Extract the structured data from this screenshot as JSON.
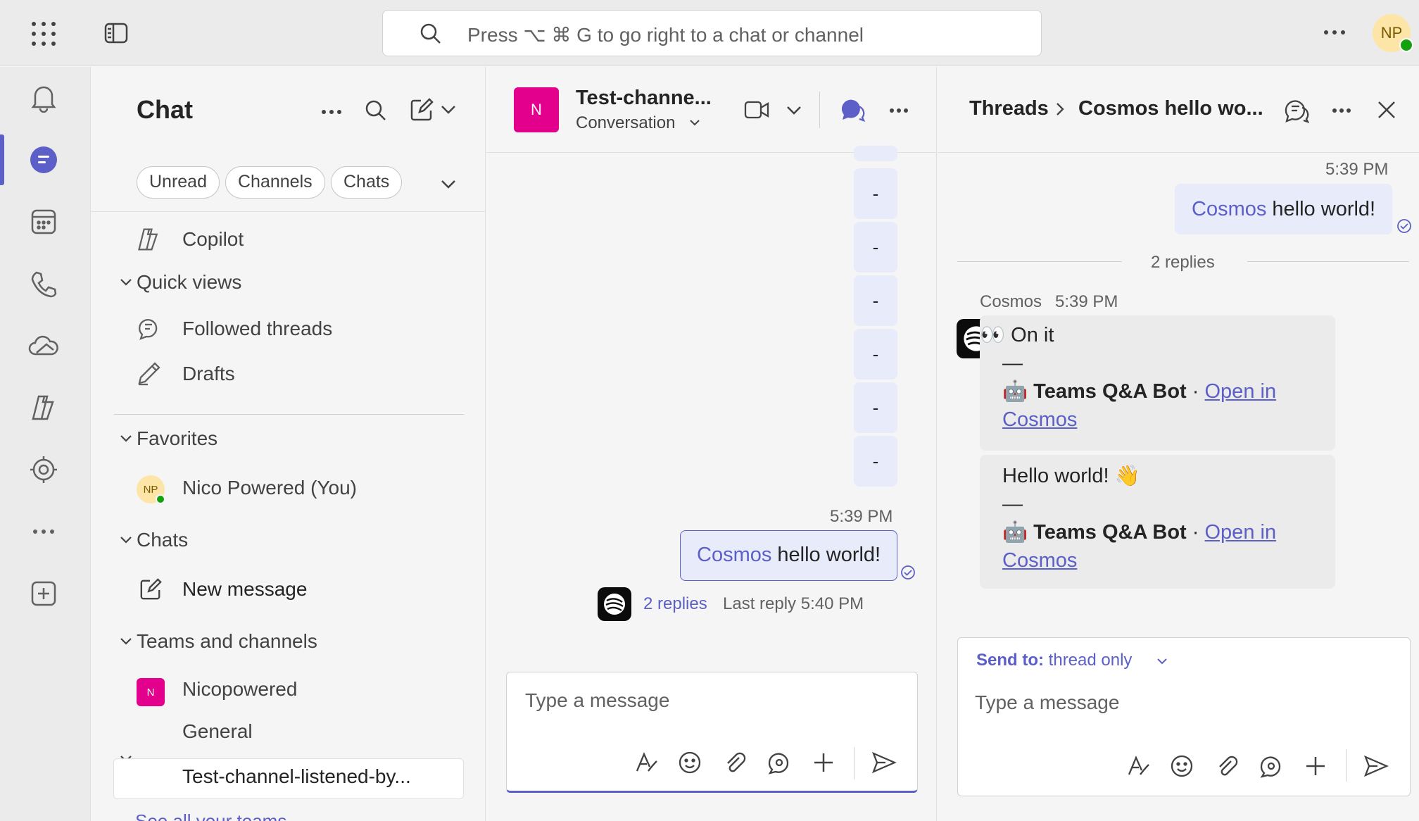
{
  "topbar": {
    "search_placeholder": "Press ⌥ ⌘ G to go right to a chat or channel",
    "user_initials": "NP"
  },
  "rail": {
    "items": [
      "bell-icon",
      "chat-icon",
      "calendar-icon",
      "phone-icon",
      "onedrive-icon",
      "copilot-icon",
      "apps-settings-icon",
      "more-icon",
      "add-app-icon"
    ],
    "active": "chat-icon"
  },
  "chat_panel": {
    "title": "Chat",
    "filters": [
      "Unread",
      "Channels",
      "Chats"
    ],
    "copilot": "Copilot",
    "quick_views": {
      "header": "Quick views",
      "items": [
        "Followed threads",
        "Drafts"
      ]
    },
    "favorites": {
      "header": "Favorites",
      "items": [
        {
          "label": "Nico Powered (You)",
          "initials": "NP"
        }
      ]
    },
    "chats": {
      "header": "Chats",
      "items": [
        "New message"
      ]
    },
    "teams": {
      "header": "Teams and channels",
      "team_name": "Nicopowered",
      "team_initial": "N",
      "channels": [
        "General",
        "Test-channel-listened-by..."
      ],
      "see_all": "See all your teams"
    }
  },
  "conversation": {
    "channel_name": "Test-channe...",
    "channel_initial": "N",
    "tab": "Conversation",
    "dash_messages": [
      "-",
      "-",
      "-",
      "-",
      "-",
      "-"
    ],
    "message": {
      "time": "5:39 PM",
      "mention": "Cosmos",
      "text": " hello world!"
    },
    "replies": {
      "count_label": "2 replies",
      "last_reply": "Last reply 5:40 PM"
    },
    "compose_placeholder": "Type a message"
  },
  "thread": {
    "breadcrumb_root": "Threads",
    "breadcrumb_current": "Cosmos hello wo...",
    "original": {
      "time": "5:39 PM",
      "mention": "Cosmos",
      "text": " hello world!"
    },
    "divider_label": "2 replies",
    "reply": {
      "author": "Cosmos",
      "time": "5:39 PM",
      "cards": [
        {
          "emoji": "👀",
          "text": "On it",
          "dash": "—",
          "bot_emoji": "🤖",
          "bot_name": "Teams Q&A Bot",
          "separator": "·",
          "link_line1": "Open in",
          "link_line2": "Cosmos"
        },
        {
          "emoji": "👋",
          "text": "Hello world!",
          "dash": "—",
          "bot_emoji": "🤖",
          "bot_name": "Teams Q&A Bot",
          "separator": "·",
          "link_line1": "Open in",
          "link_line2": "Cosmos"
        }
      ]
    },
    "send_to_label": "Send to:",
    "send_to_value": "thread only",
    "compose_placeholder": "Type a message"
  },
  "colors": {
    "brand": "#5b5fc7",
    "team_avatar": "#e3008c",
    "presence": "#13a10e"
  }
}
